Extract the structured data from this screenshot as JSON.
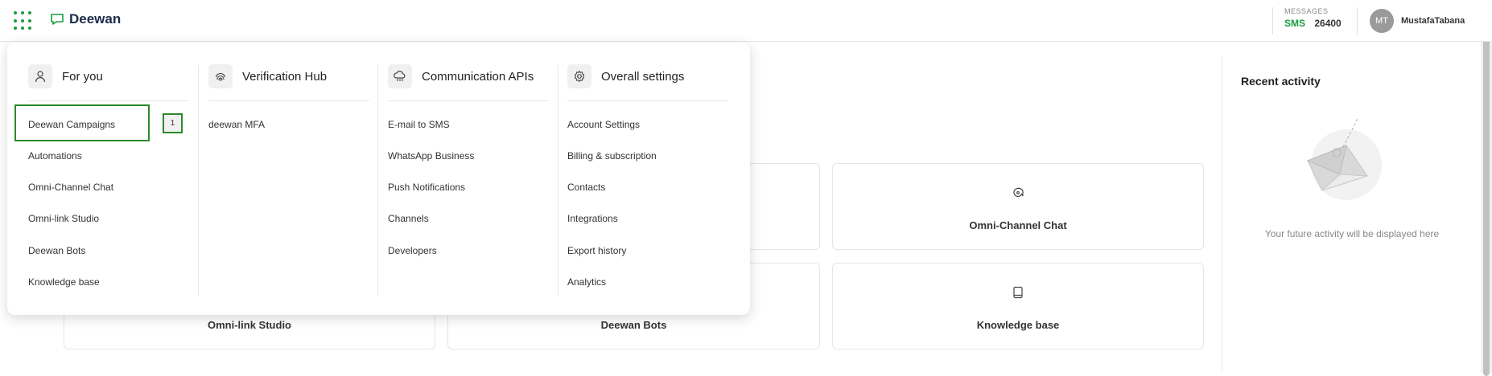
{
  "header": {
    "brand": "Deewan",
    "messages_label": "MESSAGES",
    "sms_label": "SMS",
    "sms_count": "26400",
    "avatar_initials": "MT",
    "user_name": "MustafaTabana"
  },
  "cards": [
    {
      "label": "Omni-Channel Chat",
      "icon": "chat-bubble-icon"
    },
    {
      "label": "Omni-link Studio"
    },
    {
      "label": "Deewan Bots"
    },
    {
      "label": "Knowledge base",
      "icon": "book-icon"
    }
  ],
  "recent": {
    "title": "Recent activity",
    "empty_text": "Your future activity will be displayed here"
  },
  "menu": {
    "for_you": {
      "title": "For you",
      "icon": "user-icon",
      "items": [
        "Deewan Campaigns",
        "Automations",
        "Omni-Channel Chat",
        "Omni-link Studio",
        "Deewan Bots",
        "Knowledge base"
      ],
      "badge": "1"
    },
    "verification": {
      "title": "Verification Hub",
      "icon": "fingerprint-icon",
      "items": [
        "deewan MFA"
      ]
    },
    "communication": {
      "title": "Communication APIs",
      "icon": "cloud-icon",
      "items": [
        "E-mail to SMS",
        "WhatsApp Business",
        "Push Notifications",
        "Channels",
        "Developers"
      ]
    },
    "settings": {
      "title": "Overall settings",
      "icon": "gear-icon",
      "items": [
        "Account Settings",
        "Billing & subscription",
        "Contacts",
        "Integrations",
        "Export history",
        "Analytics"
      ]
    }
  },
  "colors": {
    "brand_green": "#1a9c3d",
    "highlight_green": "#2a8a2a"
  }
}
